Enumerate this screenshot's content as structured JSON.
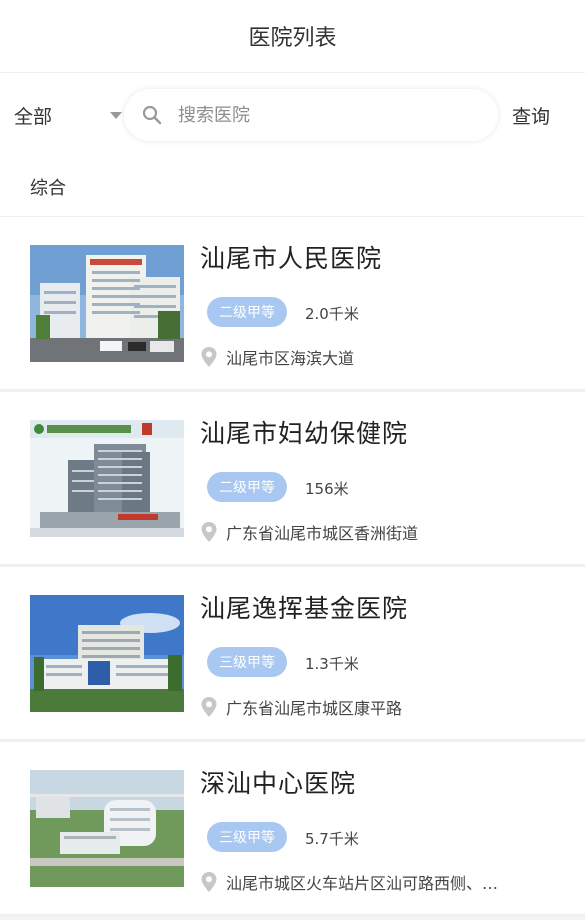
{
  "header": {
    "title": "医院列表"
  },
  "search": {
    "filter_label": "全部",
    "placeholder": "搜索医院",
    "query_label": "查询"
  },
  "tabs": [
    {
      "label": "综合"
    }
  ],
  "hospitals": [
    {
      "name": "汕尾市人民医院",
      "level": "二级甲等",
      "distance": "2.0千米",
      "address": "汕尾市区海滨大道"
    },
    {
      "name": "汕尾市妇幼保健院",
      "level": "二级甲等",
      "distance": "156米",
      "address": "广东省汕尾市城区香洲街道"
    },
    {
      "name": "汕尾逸挥基金医院",
      "level": "三级甲等",
      "distance": "1.3千米",
      "address": "广东省汕尾市城区康平路"
    },
    {
      "name": "深汕中心医院",
      "level": "三级甲等",
      "distance": "5.7千米",
      "address": "汕尾市城区火车站片区汕可路西侧、…"
    }
  ],
  "thumbnail_photo_signs": [
    "汕尾市妇幼保健院"
  ],
  "colors": {
    "level_badge": "#a9c8f1",
    "divider": "#f0f0f2"
  }
}
